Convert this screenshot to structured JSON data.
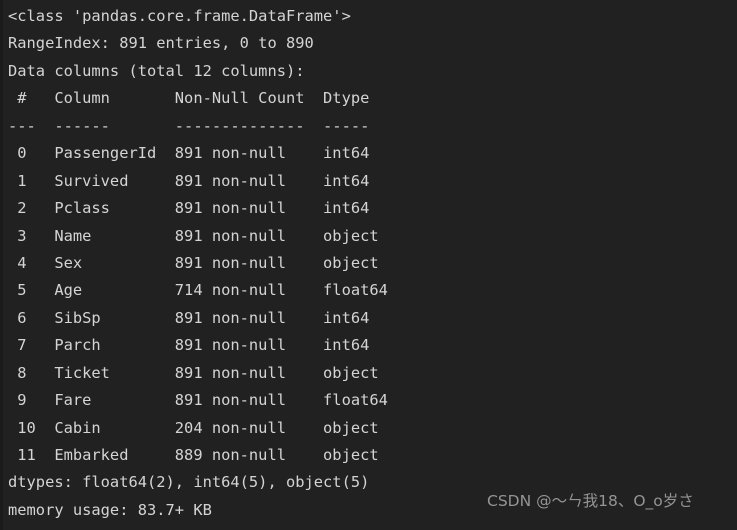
{
  "terminal": {
    "background_color": "#212121",
    "text_color": "#d4d4d4",
    "header_lines": {
      "class_line": "<class 'pandas.core.frame.DataFrame'>",
      "index_line": "RangeIndex: 891 entries, 0 to 890",
      "columns_line": "Data columns (total 12 columns):",
      "column_header": " #   Column       Non-Null Count  Dtype",
      "column_rule": "---  ------       --------------  -----"
    },
    "rows": [
      {
        "index": " 0",
        "column": "PassengerId",
        "non_null": "891 non-null",
        "dtype": "int64",
        "text": " 0   PassengerId  891 non-null    int64"
      },
      {
        "index": " 1",
        "column": "Survived",
        "non_null": "891 non-null",
        "dtype": "int64",
        "text": " 1   Survived     891 non-null    int64"
      },
      {
        "index": " 2",
        "column": "Pclass",
        "non_null": "891 non-null",
        "dtype": "int64",
        "text": " 2   Pclass       891 non-null    int64"
      },
      {
        "index": " 3",
        "column": "Name",
        "non_null": "891 non-null",
        "dtype": "object",
        "text": " 3   Name         891 non-null    object"
      },
      {
        "index": " 4",
        "column": "Sex",
        "non_null": "891 non-null",
        "dtype": "object",
        "text": " 4   Sex          891 non-null    object"
      },
      {
        "index": " 5",
        "column": "Age",
        "non_null": "714 non-null",
        "dtype": "float64",
        "text": " 5   Age          714 non-null    float64"
      },
      {
        "index": " 6",
        "column": "SibSp",
        "non_null": "891 non-null",
        "dtype": "int64",
        "text": " 6   SibSp        891 non-null    int64"
      },
      {
        "index": " 7",
        "column": "Parch",
        "non_null": "891 non-null",
        "dtype": "int64",
        "text": " 7   Parch        891 non-null    int64"
      },
      {
        "index": " 8",
        "column": "Ticket",
        "non_null": "891 non-null",
        "dtype": "object",
        "text": " 8   Ticket       891 non-null    object"
      },
      {
        "index": " 9",
        "column": "Fare",
        "non_null": "891 non-null",
        "dtype": "float64",
        "text": " 9   Fare         891 non-null    float64"
      },
      {
        "index": "10",
        "column": "Cabin",
        "non_null": "204 non-null",
        "dtype": "object",
        "text": " 10  Cabin        204 non-null    object"
      },
      {
        "index": "11",
        "column": "Embarked",
        "non_null": "889 non-null",
        "dtype": "object",
        "text": " 11  Embarked     889 non-null    object"
      }
    ],
    "footer_lines": {
      "dtypes_line": "dtypes: float64(2), int64(5), object(5)",
      "memory_line": "memory usage: 83.7+ KB"
    }
  },
  "watermark": {
    "text": "CSDN @〜ㄣ我18、O_o岁さ",
    "color": "#9b9b9b"
  }
}
